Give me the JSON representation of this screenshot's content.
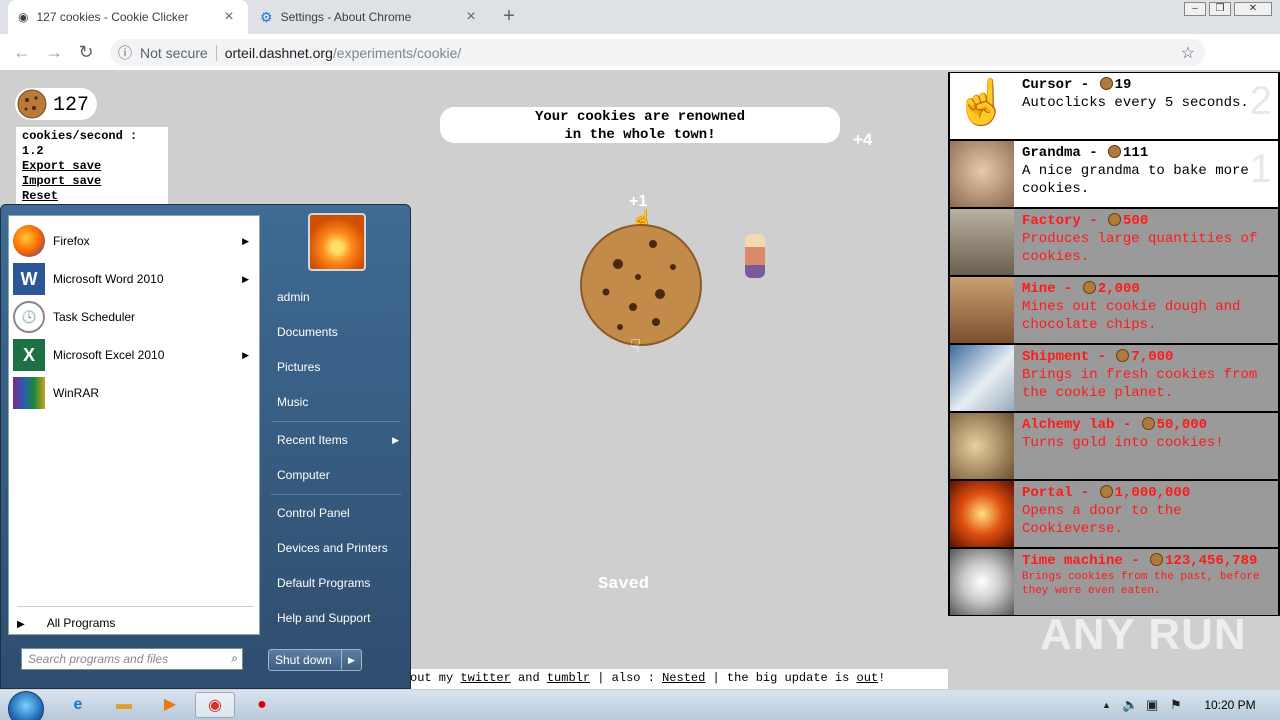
{
  "browser": {
    "tabs": [
      {
        "title": "127 cookies - Cookie Clicker",
        "active": true
      },
      {
        "title": "Settings - About Chrome",
        "active": false
      }
    ],
    "address": {
      "security": "Not secure",
      "host": "orteil.dashnet.org",
      "path": "/experiments/cookie/"
    }
  },
  "game": {
    "cookies": "127",
    "cps": "cookies/second : 1.2",
    "links": [
      "Export save",
      "Import save",
      "Reset"
    ],
    "news": [
      "Your cookies are renowned",
      "in the whole town!"
    ],
    "floaters": [
      "+4",
      "+1"
    ],
    "saved": "Saved",
    "ticker": {
      "pre": "out my ",
      "twitter": "twitter",
      "and": " and ",
      "tumblr": "tumblr",
      "also": " | also : ",
      "nested": "Nested",
      "update": " | the big update is ",
      "out": "out",
      "end": "!"
    }
  },
  "store": [
    {
      "name": "Cursor - ",
      "price": "19",
      "desc": "Autoclicks every 5 seconds.",
      "owned": "2",
      "locked": false
    },
    {
      "name": "Grandma - ",
      "price": "111",
      "desc": "A nice grandma to bake more cookies.",
      "owned": "1",
      "locked": false
    },
    {
      "name": "Factory - ",
      "price": "500",
      "desc": "Produces large quantities of cookies.",
      "owned": "",
      "locked": true
    },
    {
      "name": "Mine - ",
      "price": "2,000",
      "desc": "Mines out cookie dough and chocolate chips.",
      "owned": "",
      "locked": true
    },
    {
      "name": "Shipment - ",
      "price": "7,000",
      "desc": "Brings in fresh cookies from the cookie planet.",
      "owned": "",
      "locked": true
    },
    {
      "name": "Alchemy lab - ",
      "price": "50,000",
      "desc": "Turns gold into cookies!",
      "owned": "",
      "locked": true
    },
    {
      "name": "Portal - ",
      "price": "1,000,000",
      "desc": "Opens a door to the Cookieverse.",
      "owned": "",
      "locked": true
    },
    {
      "name": "Time machine - ",
      "price": "123,456,789",
      "desc": "Brings cookies from the past, before they were even eaten.",
      "owned": "",
      "locked": true
    }
  ],
  "startmenu": {
    "programs": [
      {
        "label": "Firefox",
        "arrow": true
      },
      {
        "label": "Microsoft Word 2010",
        "arrow": true
      },
      {
        "label": "Task Scheduler",
        "arrow": false
      },
      {
        "label": "Microsoft Excel 2010",
        "arrow": true
      },
      {
        "label": "WinRAR",
        "arrow": false
      }
    ],
    "all_programs": "All Programs",
    "search_placeholder": "Search programs and files",
    "right": [
      "admin",
      "Documents",
      "Pictures",
      "Music",
      "Recent Items",
      "Computer",
      "Control Panel",
      "Devices and Printers",
      "Default Programs",
      "Help and Support"
    ],
    "shutdown": "Shut down"
  },
  "taskbar": {
    "time": "10:20 PM"
  },
  "watermark": "ANY RUN"
}
